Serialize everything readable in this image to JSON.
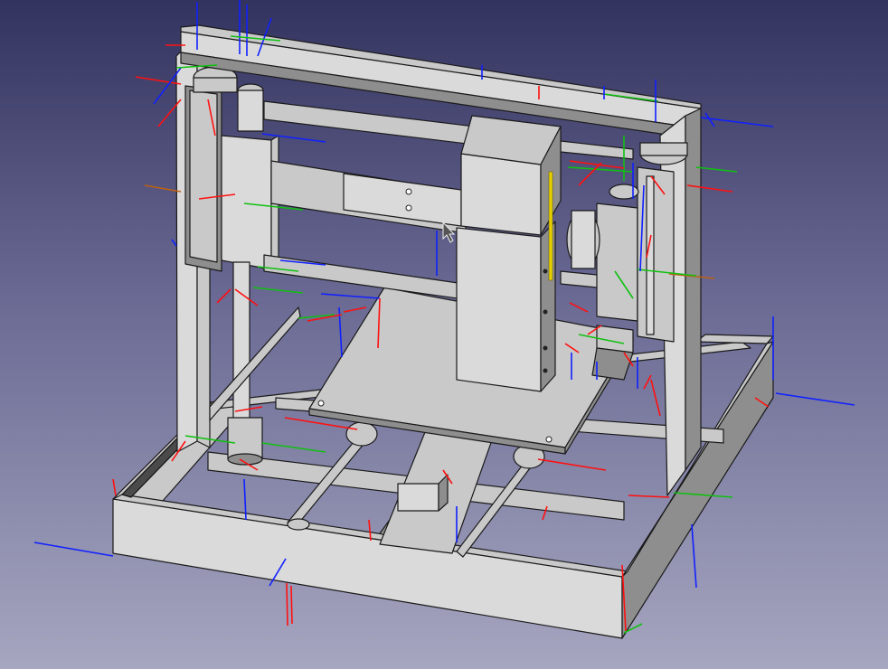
{
  "viewport": {
    "background_top": "#33335f",
    "background_bottom": "#a6a6c0"
  },
  "model": {
    "material_color": "#c9c9c9",
    "edge_color": "#1a1a1a",
    "highlight_color": "#e8d000"
  },
  "axes": {
    "x_color": "#ff1010",
    "y_color": "#10c010",
    "z_color": "#1020ff"
  },
  "cursor": {
    "icon": "arrow-pointer-icon"
  }
}
